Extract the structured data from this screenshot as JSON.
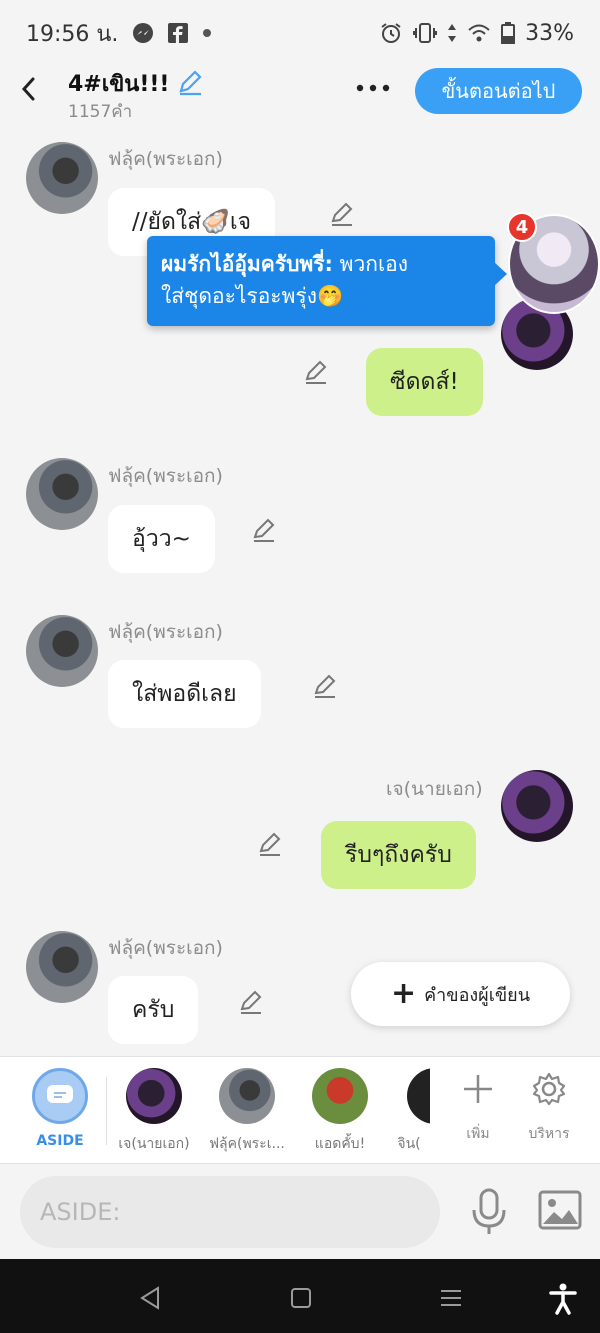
{
  "status_bar": {
    "time": "19:56 น.",
    "battery": "33%",
    "icons": [
      "messenger-icon",
      "facebook-icon",
      "dot-icon",
      "alarm-icon",
      "vibrate-icon",
      "data-arrows-icon",
      "wifi-icon",
      "battery-icon"
    ]
  },
  "header": {
    "title": "4#เขิน!!!",
    "word_count": "1157คำ",
    "next_button": "ขั้นตอนต่อไป"
  },
  "messages": [
    {
      "sender": "ฟลุ้ค(พระเอก)",
      "text": "//ยัดใส่🦪เจ",
      "side": "left"
    },
    {
      "sender": "",
      "text": "ซีดดส์!",
      "side": "right"
    },
    {
      "sender": "ฟลุ้ค(พระเอก)",
      "text": "อุ้วว~",
      "side": "left"
    },
    {
      "sender": "ฟลุ้ค(พระเอก)",
      "text": "ใส่พอดีเลย",
      "side": "left"
    },
    {
      "sender": "เจ(นายเอก)",
      "text": "รีบๆถึงครับ",
      "side": "right"
    },
    {
      "sender": "ฟลุ้ค(พระเอก)",
      "text": "ครับ",
      "side": "left"
    }
  ],
  "notification": {
    "sender": "ผมรักไอ้อุ้มครับพรี่:",
    "text_line1": "พวกเอง",
    "text_line2": "ใส่ชุดอะไรอะพรุ่ง🤭",
    "badge": "4"
  },
  "author_words_button": "คำของผู้เขียน",
  "characters": [
    {
      "label": "ASIDE"
    },
    {
      "label": "เจ(นายเอก)"
    },
    {
      "label": "ฟลุ้ค(พระเ..."
    },
    {
      "label": "แอดคั้บ!"
    },
    {
      "label": "จิน("
    }
  ],
  "tools": {
    "add_label": "เพิ่ม",
    "manage_label": "บริหาร"
  },
  "input": {
    "placeholder": "ASIDE:"
  },
  "colors": {
    "accent_blue": "#3aa0f6",
    "outgoing_bubble": "#cdf08a",
    "incoming_bubble": "#ffffff",
    "badge_red": "#e8352b"
  }
}
